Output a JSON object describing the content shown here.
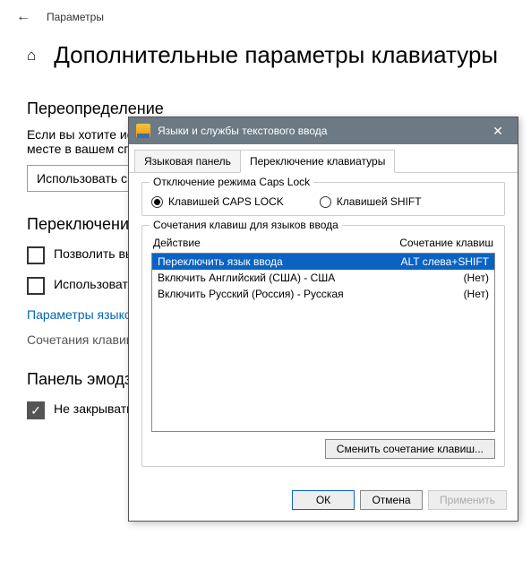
{
  "settings": {
    "app_title": "Параметры",
    "page_title": "Дополнительные параметры клавиатуры",
    "section_override_heading": "Переопределение",
    "override_text": "Если вы хотите использовать метод ввода, отличный от указанного на первом месте в вашем списке языков",
    "dropdown_label": "Использовать список языков (рекомендуется)",
    "section_switch_heading": "Переключение методов ввода",
    "cb_allow_label": "Позволить выбирать метод ввода для каждого приложения",
    "cb_use_desktop_label": "Использовать языковую панель на рабочем столе, если она доступна",
    "link_lang_panel": "Параметры языковой панели",
    "link_hotkeys": "Сочетания клавиш для языков ввода",
    "section_emoji_heading": "Панель эмодзи",
    "cb_emoji_label": "Не закрывать панель автоматически после ввода эмодзи"
  },
  "dialog": {
    "title": "Языки и службы текстового ввода",
    "tabs": {
      "lang_panel": "Языковая панель",
      "switch_kb": "Переключение клавиатуры"
    },
    "capslock_group": {
      "legend": "Отключение режима Caps Lock",
      "radio_capslock": "Клавишей CAPS LOCK",
      "radio_shift": "Клавишей SHIFT"
    },
    "hotkeys_group": {
      "legend": "Сочетания клавиш для языков ввода",
      "col_action": "Действие",
      "col_hotkey": "Сочетание клавиш",
      "rows": [
        {
          "action": "Переключить язык ввода",
          "hotkey": "ALT слева+SHIFT"
        },
        {
          "action": "Включить Английский (США) - США",
          "hotkey": "(Нет)"
        },
        {
          "action": "Включить Русский (Россия) - Русская",
          "hotkey": "(Нет)"
        }
      ],
      "change_button": "Сменить сочетание клавиш..."
    },
    "buttons": {
      "ok": "ОК",
      "cancel": "Отмена",
      "apply": "Применить"
    }
  }
}
